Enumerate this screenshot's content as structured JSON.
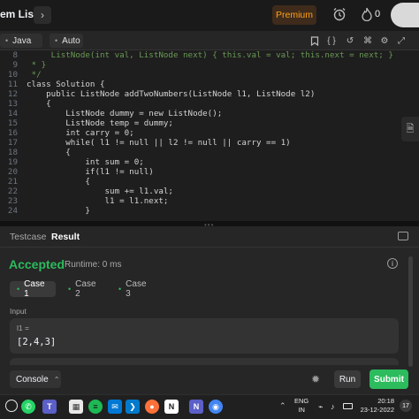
{
  "header": {
    "title": "em List",
    "next_icon": "chevron-right-icon",
    "premium_label": "Premium",
    "fire_count": "0"
  },
  "editor_toolbar": {
    "language": "Java",
    "mode": "Auto"
  },
  "code": {
    "lines": [
      {
        "n": "8",
        "text": "     ListNode(int val, ListNode next) { this.val = val; this.next = next; }"
      },
      {
        "n": "9",
        "text": " * }"
      },
      {
        "n": "10",
        "text": " */"
      },
      {
        "n": "11",
        "text": "class Solution {"
      },
      {
        "n": "12",
        "text": "    public ListNode addTwoNumbers(ListNode l1, ListNode l2)"
      },
      {
        "n": "13",
        "text": "    {"
      },
      {
        "n": "14",
        "text": "        ListNode dummy = new ListNode();"
      },
      {
        "n": "15",
        "text": "        ListNode temp = dummy;"
      },
      {
        "n": "16",
        "text": "        int carry = 0;"
      },
      {
        "n": "17",
        "text": "        while( l1 != null || l2 != null || carry == 1)"
      },
      {
        "n": "18",
        "text": "        {"
      },
      {
        "n": "19",
        "text": "            int sum = 0;"
      },
      {
        "n": "20",
        "text": "            if(l1 != null)"
      },
      {
        "n": "21",
        "text": "            {"
      },
      {
        "n": "22",
        "text": "                sum += l1.val;"
      },
      {
        "n": "23",
        "text": "                l1 = l1.next;"
      },
      {
        "n": "24",
        "text": "            }"
      }
    ]
  },
  "result_panel": {
    "tabs": [
      "Testcase",
      "Result"
    ],
    "status": "Accepted",
    "runtime": "Runtime: 0 ms",
    "cases": [
      "Case 1",
      "Case 2",
      "Case 3"
    ],
    "input_label": "Input",
    "var_name": "l1 =",
    "var_value": "[2,4,3]"
  },
  "actions": {
    "console_label": "Console",
    "run_label": "Run",
    "submit_label": "Submit"
  },
  "taskbar": {
    "language_line1": "ENG",
    "language_line2": "IN",
    "time": "20:18",
    "date": "23-12-2022",
    "notification_count": "17"
  },
  "colors": {
    "accepted": "#2cbb5d",
    "premium": "#ffa116",
    "submit": "#2cbb5d"
  }
}
